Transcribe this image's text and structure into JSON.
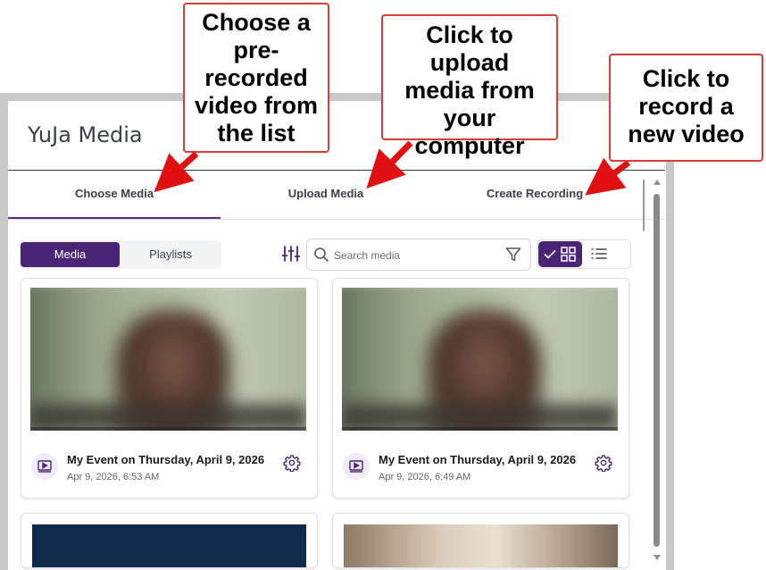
{
  "app": {
    "title": "YuJa Media"
  },
  "tabs": [
    {
      "label": "Choose Media",
      "active": true
    },
    {
      "label": "Upload Media",
      "active": false
    },
    {
      "label": "Create Recording",
      "active": false
    }
  ],
  "segment": {
    "media_label": "Media",
    "playlists_label": "Playlists",
    "selected": "Media"
  },
  "search": {
    "placeholder": "Search media",
    "value": ""
  },
  "view": {
    "selected": "grid"
  },
  "media_items": [
    {
      "title": "My Event on Thursday, April 9, 2026",
      "date": "Apr 9, 2026, 6:53 AM",
      "icon": "video-file-icon"
    },
    {
      "title": "My Event on Thursday, April 9, 2026",
      "date": "Apr 9, 2026, 6:49 AM",
      "icon": "video-file-icon"
    }
  ],
  "callouts": [
    {
      "text": "Choose a pre-recorded video from the list"
    },
    {
      "text": "Click to upload media from your computer"
    },
    {
      "text": "Click to record a new video"
    }
  ],
  "colors": {
    "accent": "#4a2577",
    "callout_border": "#d93b3b",
    "arrow": "#e01010"
  }
}
